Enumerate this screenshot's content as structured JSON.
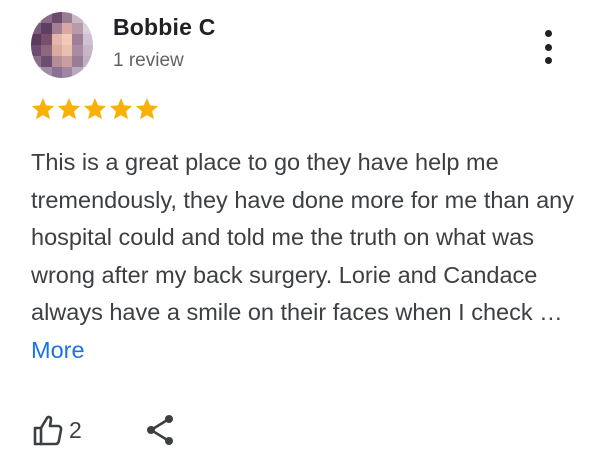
{
  "review": {
    "reviewer_name": "Bobbie C",
    "review_count": "1 review",
    "rating": 5,
    "rating_max": 5,
    "text": "This is a great place to go they have help me tremendously, they have done more for me than any hospital could and told me the truth on what was wrong after my back surgery. Lorie and Candace always have a smile on their faces when I check …",
    "more_label": "More",
    "like_count": "2"
  },
  "icons": {
    "avatar": "blurred-avatar",
    "menu": "more-vertical-icon",
    "star": "star-icon",
    "like": "thumbs-up-icon",
    "share": "share-icon"
  },
  "colors": {
    "star": "#F9B107",
    "link": "#1A73E8",
    "name": "#202124",
    "secondary": "#5F6368",
    "body_text": "#3C4043"
  }
}
